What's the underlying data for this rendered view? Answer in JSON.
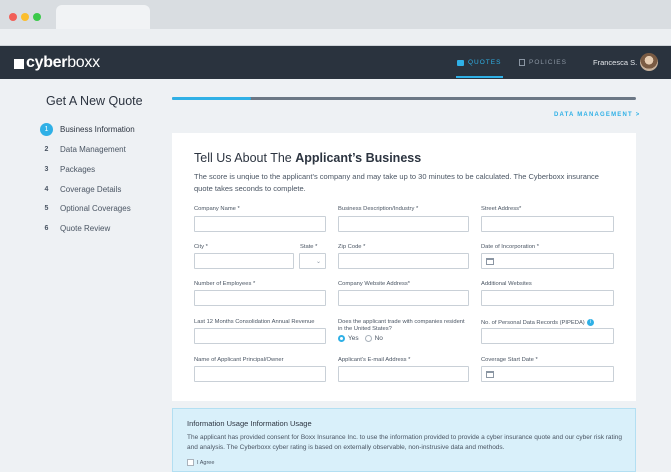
{
  "brand": {
    "name_bold": "cyber",
    "name_light": "boxx"
  },
  "nav": {
    "quotes": "QUOTES",
    "policies": "POLICIES",
    "user": "Francesca S."
  },
  "sidebar": {
    "title": "Get A New Quote",
    "steps": [
      {
        "num": "1",
        "label": "Business Information",
        "active": true
      },
      {
        "num": "2",
        "label": "Data Management"
      },
      {
        "num": "3",
        "label": "Packages"
      },
      {
        "num": "4",
        "label": "Coverage Details"
      },
      {
        "num": "5",
        "label": "Optional Coverages"
      },
      {
        "num": "6",
        "label": "Quote Review"
      }
    ]
  },
  "progress": {
    "fraction": 0.17,
    "next_label": "DATA MANAGEMENT  >"
  },
  "form": {
    "title_prefix": "Tell Us About The ",
    "title_bold": "Applicant’s Business",
    "description": "The score is unqiue to the applicant’s company and may take up to 30 minutes to be calculated. The Cyberboxx insurance quote takes seconds to complete.",
    "fields": {
      "company_name": "Company Name *",
      "business_description": "Business Description/Industry *",
      "street_address": "Street Address*",
      "city": "City *",
      "state": "State *",
      "zip": "Zip Code *",
      "incorporation_date": "Date of Incorporation *",
      "employees": "Number of Employees *",
      "website": "Company Website Address*",
      "additional_websites": "Additional Websites",
      "revenue": "Last 12 Months Consolidation Annual Revenue",
      "trade_question": "Does the applicant trade with companies resident in the United States?",
      "personal_records": "No. of Personal Data Records (PIPEDA)",
      "principal_name": "Name of Applicant Principal/Owner",
      "email": "Applicant’s E-mail Address *",
      "coverage_start": "Coverage Start Date *"
    },
    "radio": {
      "yes": "Yes",
      "no": "No",
      "selected": "yes"
    }
  },
  "info_usage": {
    "title": "Information Usage   Information Usage",
    "text": "The applicant has provided consent for Boxx Insurance Inc. to use the information provided to provide a cyber insurance quote and our cyber risk rating and analysis. The Cyberboxx cyber rating is based on externally observable, non-instrusive data and methods.",
    "agree_label": "I Agree"
  }
}
